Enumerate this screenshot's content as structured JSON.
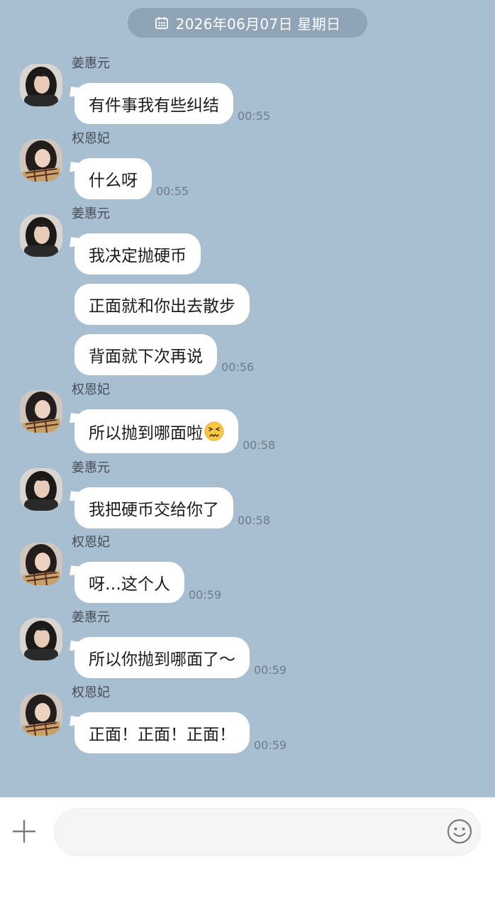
{
  "header": {
    "date_label": "2026年06月07日  星期日"
  },
  "contacts": {
    "a": {
      "name": "姜惠元"
    },
    "b": {
      "name": "权恩妃"
    }
  },
  "messages": [
    {
      "sender": "姜惠元",
      "bubbles": [
        "有件事我有些纠结"
      ],
      "time": "00:55"
    },
    {
      "sender": "权恩妃",
      "bubbles": [
        "什么呀"
      ],
      "time": "00:55"
    },
    {
      "sender": "姜惠元",
      "bubbles": [
        "我决定抛硬币",
        "正面就和你出去散步",
        "背面就下次再说"
      ],
      "time": "00:56"
    },
    {
      "sender": "权恩妃",
      "bubbles": [
        "所以抛到哪面啦"
      ],
      "time": "00:58",
      "emoji": "confounded-face"
    },
    {
      "sender": "姜惠元",
      "bubbles": [
        "我把硬币交给你了"
      ],
      "time": "00:58"
    },
    {
      "sender": "权恩妃",
      "bubbles": [
        "呀…这个人"
      ],
      "time": "00:59"
    },
    {
      "sender": "姜惠元",
      "bubbles": [
        "所以你抛到哪面了～"
      ],
      "time": "00:59"
    },
    {
      "sender": "权恩妃",
      "bubbles": [
        "正面！正面！正面！"
      ],
      "time": "00:59"
    }
  ],
  "input": {
    "value": "",
    "placeholder": ""
  },
  "icons": {
    "date": "calendar-icon",
    "add": "plus-icon",
    "emoji": "smiley-icon"
  },
  "colors": {
    "chat_background": "#a8bed1",
    "date_pill": "#8fa4b6",
    "bubble": "#ffffff",
    "timestamp": "#6e7c89",
    "sender_name": "#454d56"
  }
}
